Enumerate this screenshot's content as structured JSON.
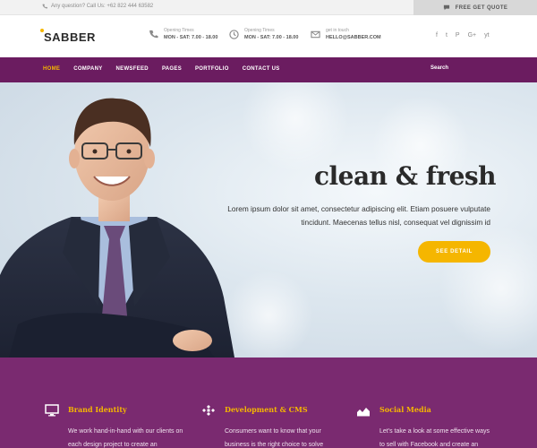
{
  "topbar": {
    "question": "Any question? Call Us: +62 822 444 63582",
    "quote": "FREE GET QUOTE"
  },
  "header": {
    "logo": "SABBER",
    "info": [
      {
        "label": "Opening Times",
        "value": "MON - SAT: 7.00 - 18.00"
      },
      {
        "label": "Opening Times",
        "value": "MON - SAT: 7.00 - 18.00"
      },
      {
        "label": "get in touch",
        "value": "HELLO@SABBER.COM"
      }
    ],
    "social": [
      "f",
      "t",
      "P",
      "G+",
      "yt"
    ]
  },
  "nav": {
    "items": [
      "HOME",
      "COMPANY",
      "NEWSFEED",
      "PAGES",
      "PORTFOLIO",
      "CONTACT US"
    ],
    "search": "Search"
  },
  "hero": {
    "title": "clean & fresh",
    "text": "Lorem ipsum dolor sit amet, consectetur adipiscing elit. Etiam posuere vulputate tincidunt. Maecenas tellus nisl, consequat vel dignissim id",
    "cta": "SEE DETAIL"
  },
  "features": [
    {
      "icon": "monitor-icon",
      "title": "Brand Identity",
      "text": "We work hand-in-hand with our clients on each design project to create an"
    },
    {
      "icon": "joomla-icon",
      "title": "Development & CMS",
      "text": "Consumers want to know that your business is the right choice to solve"
    },
    {
      "icon": "chart-icon",
      "title": "Social Media",
      "text": "Let's take a look at some effective ways to sell with Facebook and create an"
    }
  ],
  "colors": {
    "brand_purple": "#6b1c60",
    "accent_yellow": "#f5b600"
  }
}
